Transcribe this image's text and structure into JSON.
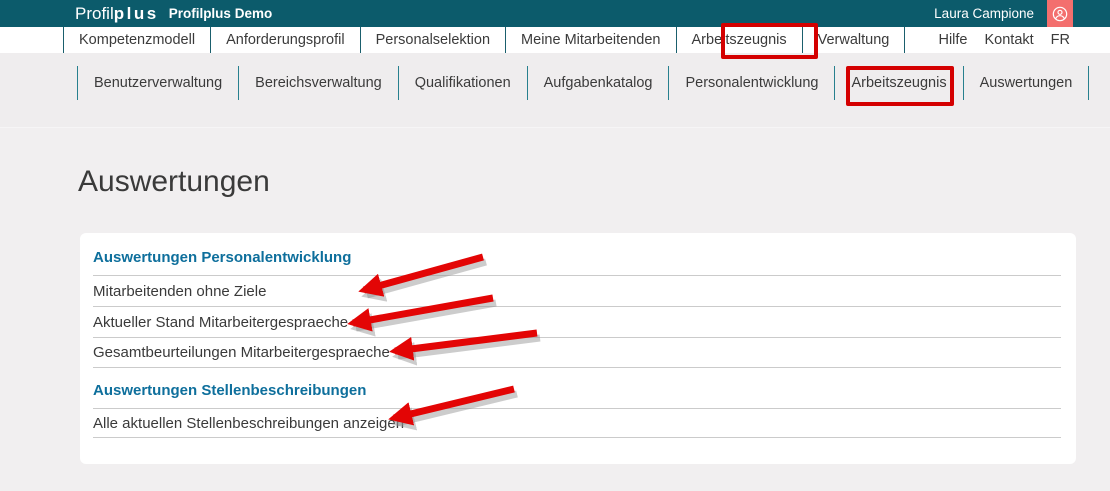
{
  "header": {
    "brand_light": "Profil",
    "brand_bold": "plus",
    "app_name": "Profilplus Demo",
    "user_name": "Laura Campione",
    "avatar_icon": "account-circle-icon"
  },
  "nav": {
    "items": [
      "Kompetenzmodell",
      "Anforderungsprofil",
      "Personalselektion",
      "Meine Mitarbeitenden",
      "Arbeitszeugnis",
      "Verwaltung"
    ],
    "right_items": [
      "Hilfe",
      "Kontakt",
      "FR"
    ]
  },
  "subnav": {
    "items": [
      "Benutzerverwaltung",
      "Bereichsverwaltung",
      "Qualifikationen",
      "Aufgabenkatalog",
      "Personalentwicklung",
      "Arbeitszeugnis",
      "Auswertungen"
    ]
  },
  "page": {
    "title": "Auswertungen"
  },
  "card": {
    "sections": [
      {
        "heading": "Auswertungen Personalentwicklung",
        "links": [
          "Mitarbeitenden ohne Ziele",
          "Aktueller Stand Mitarbeitergespraeche",
          "Gesamtbeurteilungen Mitarbeitergespraeche"
        ]
      },
      {
        "heading": "Auswertungen Stellenbeschreibungen",
        "links": [
          "Alle aktuellen Stellenbeschreibungen anzeigen"
        ]
      }
    ]
  },
  "annotations": {
    "boxed_items": [
      "Verwaltung",
      "Auswertungen"
    ],
    "box_color": "#d40000",
    "arrow_color": "#e30505",
    "arrow_count": 4
  },
  "colors": {
    "header_bg": "#0c5b6b",
    "avatar_bg": "#f36f6e",
    "section_heading": "#0e6f9c",
    "page_bg": "#f1eff0"
  }
}
